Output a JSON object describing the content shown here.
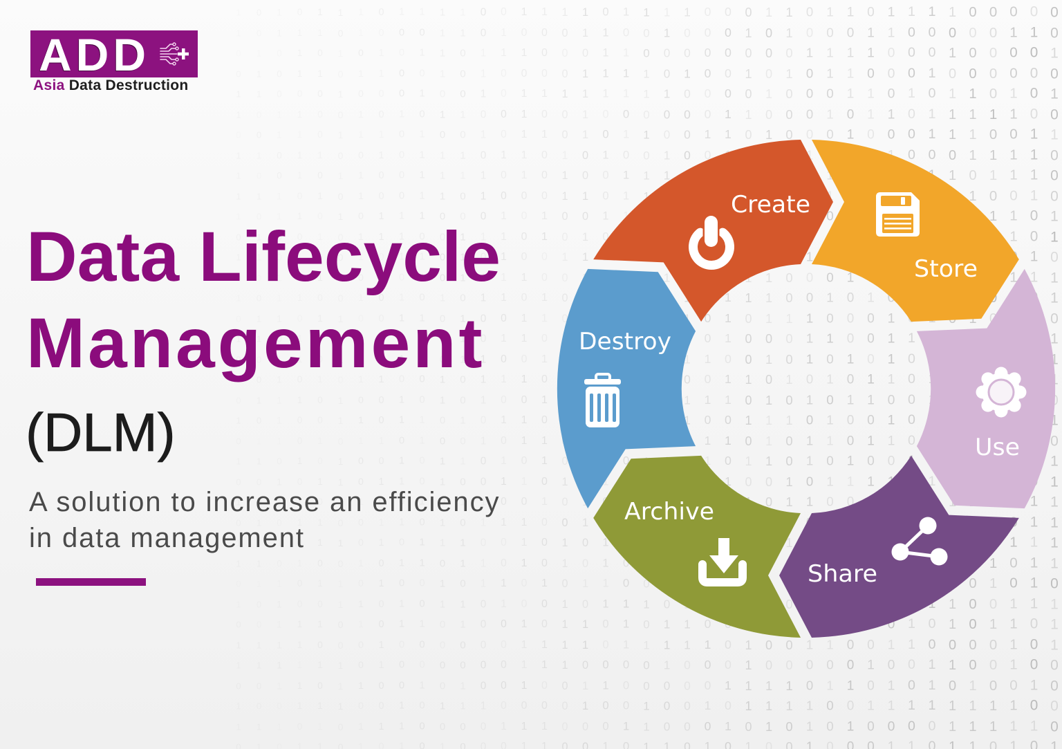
{
  "logo": {
    "wordmark": "ADD",
    "tagline_accent": "Asia",
    "tagline_rest": "Data Destruction",
    "icon": "circuit-plus-icon"
  },
  "hero": {
    "title_lines": [
      "Data Lifecycle",
      "Management"
    ],
    "abbreviation": "(DLM)",
    "subtitle_lines": [
      "A solution to increase an efficiency",
      "in data management"
    ]
  },
  "colors": {
    "brand_purple": "#8C127F",
    "title_text": "#8B0C7C",
    "abbreviation_text": "#1C1C1C",
    "subtitle_text": "#4A4A4A"
  },
  "lifecycle": {
    "stages": [
      {
        "label": "Create",
        "icon": "power-icon",
        "color": "#D4572B"
      },
      {
        "label": "Store",
        "icon": "floppy-disk-icon",
        "color": "#F2A62A"
      },
      {
        "label": "Use",
        "icon": "gear-icon",
        "color": "#D4B5D6"
      },
      {
        "label": "Share",
        "icon": "share-icon",
        "color": "#744B86"
      },
      {
        "label": "Archive",
        "icon": "download-tray-icon",
        "color": "#8F9A37"
      },
      {
        "label": "Destroy",
        "icon": "trash-icon",
        "color": "#5B9CCD"
      }
    ]
  },
  "background": {
    "binary_rows": [
      "10101110111100111101111000110110111100000",
      "10111010001101000110010001010001100000110",
      "01010101011011100011000000001111000100001",
      "01011011001010000111101001010110001000000",
      "11000100010010111111110000100011010110101",
      "10110010101100100100000011000101101111100",
      "00110111010010110101100110100010001110011",
      "11011001011101101010010011001110100011110",
      "10010110011110101001111000110101001101110",
      "11101010011010001101100101010111001010010",
      "10110101110001010011010101110001101011101",
      "01001011100111010100101000101101011010101",
      "11010010110101001110100100011100101110010",
      "00101101010111100101110101100010110100111",
      "10110010101011010011001011100101011100101",
      "01101100110100110101011010111000101010010",
      "11010110100101101010111010001100111010011",
      "00110101110110010100101100101010100101101",
      "10101011001011100110110011010101101001011",
      "01110100101010011011001110101011001010100",
      "10100110110101101001111001110100101110101",
      "01101011010010110101000110101101100001110",
      "11010100101101010010110101101010011101001",
      "00101101101001101011011010010111101011101",
      "10110110010110010101101011011001010110111",
      "01011001101011100101010110100110101010011",
      "10101101011100101011110100111011110010111",
      "11010010110110101010111011001101000101011",
      "01101101001011010110010110111010110101010",
      "10100110101101001011101011001011101100111",
      "00111010110100101101011001101001010101101",
      "11110001000000111101111101001100110000101",
      "11111101000000111000010001000001001100100",
      "00110110010100100110000011110110101010010",
      "10011100101110000100100101111001111111100",
      "11101011100001110001100010101010000111110",
      "01011010101000110010110101001000110110101"
    ]
  }
}
